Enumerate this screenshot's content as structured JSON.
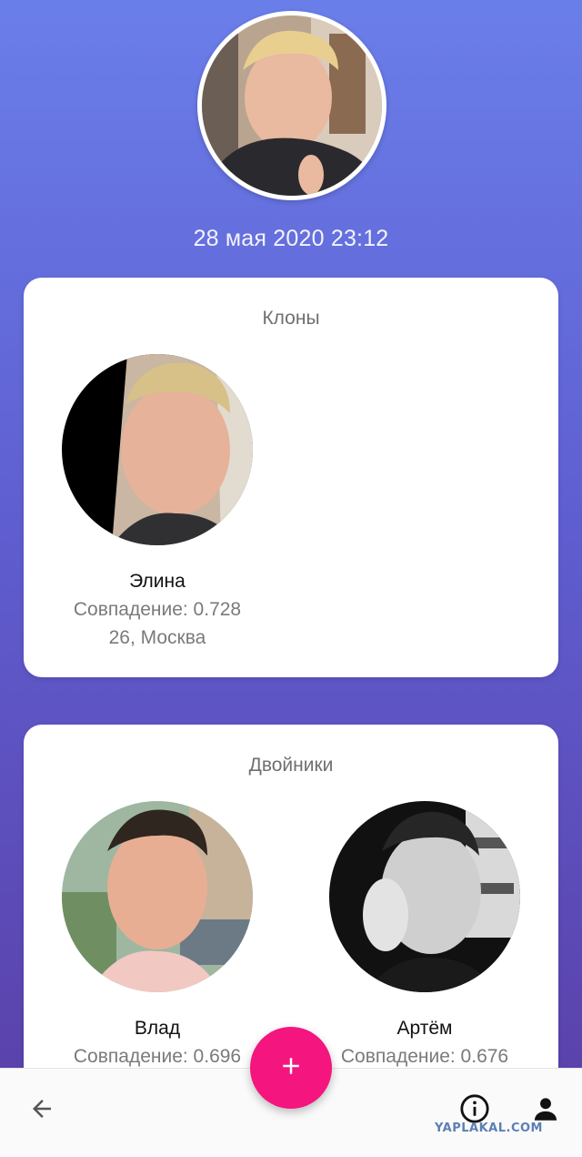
{
  "header": {
    "avatar": "profile-photo",
    "datetime": "28 мая 2020 23:12"
  },
  "clones": {
    "title": "Клоны",
    "items": [
      {
        "name": "Элина",
        "score": "Совпадение: 0.728",
        "meta": "26, Москва"
      }
    ]
  },
  "doubles": {
    "title": "Двойники",
    "items": [
      {
        "name": "Влад",
        "score": "Совпадение: 0.696"
      },
      {
        "name": "Артём",
        "score": "Совпадение: 0.676"
      }
    ]
  },
  "bottom_nav": {
    "back_icon": "arrow-left-icon",
    "fab_icon": "plus-icon",
    "info_icon": "info-icon",
    "profile_icon": "person-icon"
  },
  "watermark": "YAPLAKAL.COM",
  "colors": {
    "accent": "#f4157f",
    "gradient_top": "#6a7ee9",
    "gradient_bottom": "#5a3ea6"
  }
}
